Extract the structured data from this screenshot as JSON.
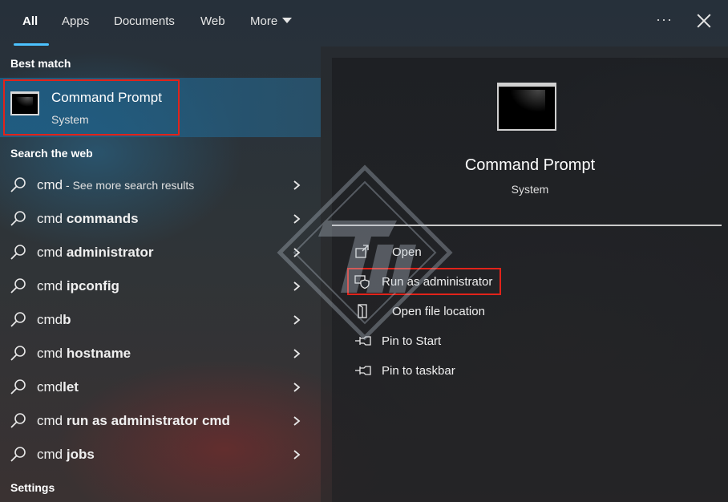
{
  "tabs": [
    {
      "label": "All",
      "active": true
    },
    {
      "label": "Apps"
    },
    {
      "label": "Documents"
    },
    {
      "label": "Web"
    },
    {
      "label": "More"
    }
  ],
  "top_actions": {
    "more_options": "···"
  },
  "best_match": {
    "header": "Best match",
    "title": "Command Prompt",
    "subtitle": "System"
  },
  "search_web": {
    "header": "Search the web",
    "items": [
      {
        "prefix": "cmd",
        "bold": "",
        "hint": " - See more search results"
      },
      {
        "prefix": "cmd ",
        "bold": "commands",
        "hint": ""
      },
      {
        "prefix": "cmd ",
        "bold": "administrator",
        "hint": ""
      },
      {
        "prefix": "cmd ",
        "bold": "ipconfig",
        "hint": ""
      },
      {
        "prefix": "cmd",
        "bold": "b",
        "hint": ""
      },
      {
        "prefix": "cmd ",
        "bold": "hostname",
        "hint": ""
      },
      {
        "prefix": "cmd",
        "bold": "let",
        "hint": ""
      },
      {
        "prefix": "cmd ",
        "bold": "run as administrator cmd",
        "hint": ""
      },
      {
        "prefix": "cmd ",
        "bold": "jobs",
        "hint": ""
      }
    ]
  },
  "settings_header": "Settings",
  "detail": {
    "title": "Command Prompt",
    "subtitle": "System",
    "actions": [
      {
        "label": "Open",
        "icon": "open-icon"
      },
      {
        "label": "Run as administrator",
        "icon": "shield-icon"
      },
      {
        "label": "Open file location",
        "icon": "folder-icon"
      },
      {
        "label": "Pin to Start",
        "icon": "pin-icon"
      },
      {
        "label": "Pin to taskbar",
        "icon": "pin-icon"
      }
    ]
  },
  "colors": {
    "accent": "#4cc2ff",
    "highlight_outline": "#e2231a",
    "selection": "#1e5f87"
  }
}
